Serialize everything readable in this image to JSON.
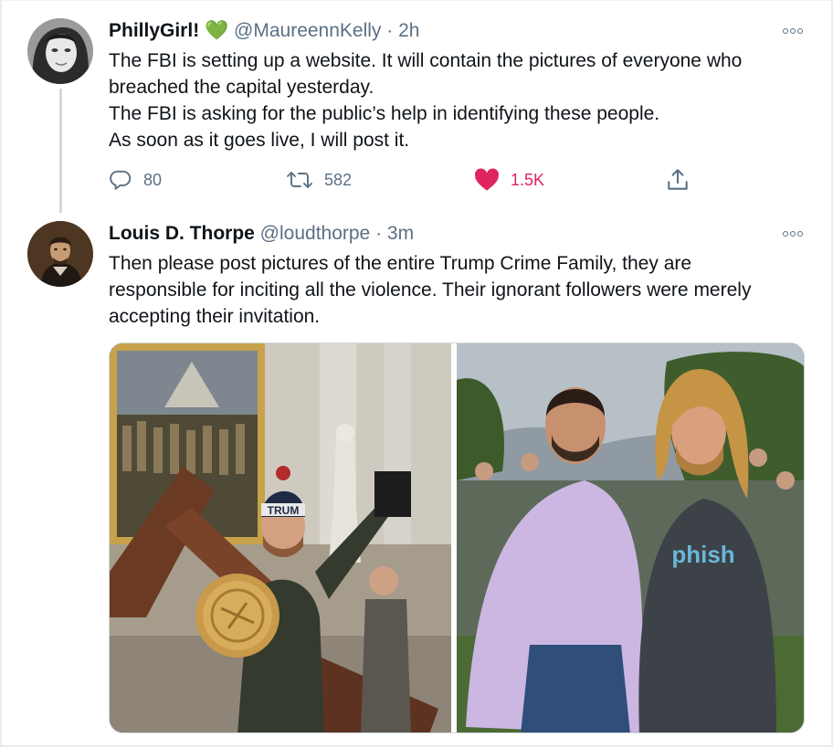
{
  "tweet1": {
    "name": "PhillyGirl!",
    "name_emoji": "💚",
    "handle": "@MaureennKelly",
    "time": "· 2h",
    "lines": [
      "The FBI is setting up a website. It will contain the pictures of everyone who",
      "breached the capital yesterday.",
      "The FBI is asking for the public’s help in identifying these people.",
      "As soon as it goes live, I will post it."
    ],
    "replies": "80",
    "retweets": "582",
    "likes": "1.5K",
    "like_color": "#e0245e"
  },
  "tweet2": {
    "name": "Louis D. Thorpe",
    "handle": "@loudthorpe",
    "time": "· 3m",
    "lines": [
      "Then please post pictures of the entire Trump Crime Family, they are",
      "responsible for inciting all the violence. Their ignorant followers were merely",
      "accepting their invitation."
    ],
    "media": {
      "hat_text": "TRUM",
      "shirt_text": "phish"
    }
  },
  "colors": {
    "text": "#0f1419",
    "secondary": "#5b7083",
    "heart": "#e0245e",
    "thread_line": "#cfd9de"
  },
  "icons": {
    "reply": "reply-icon",
    "retweet": "retweet-icon",
    "like": "heart-icon",
    "share": "share-icon",
    "more": "more-icon"
  }
}
